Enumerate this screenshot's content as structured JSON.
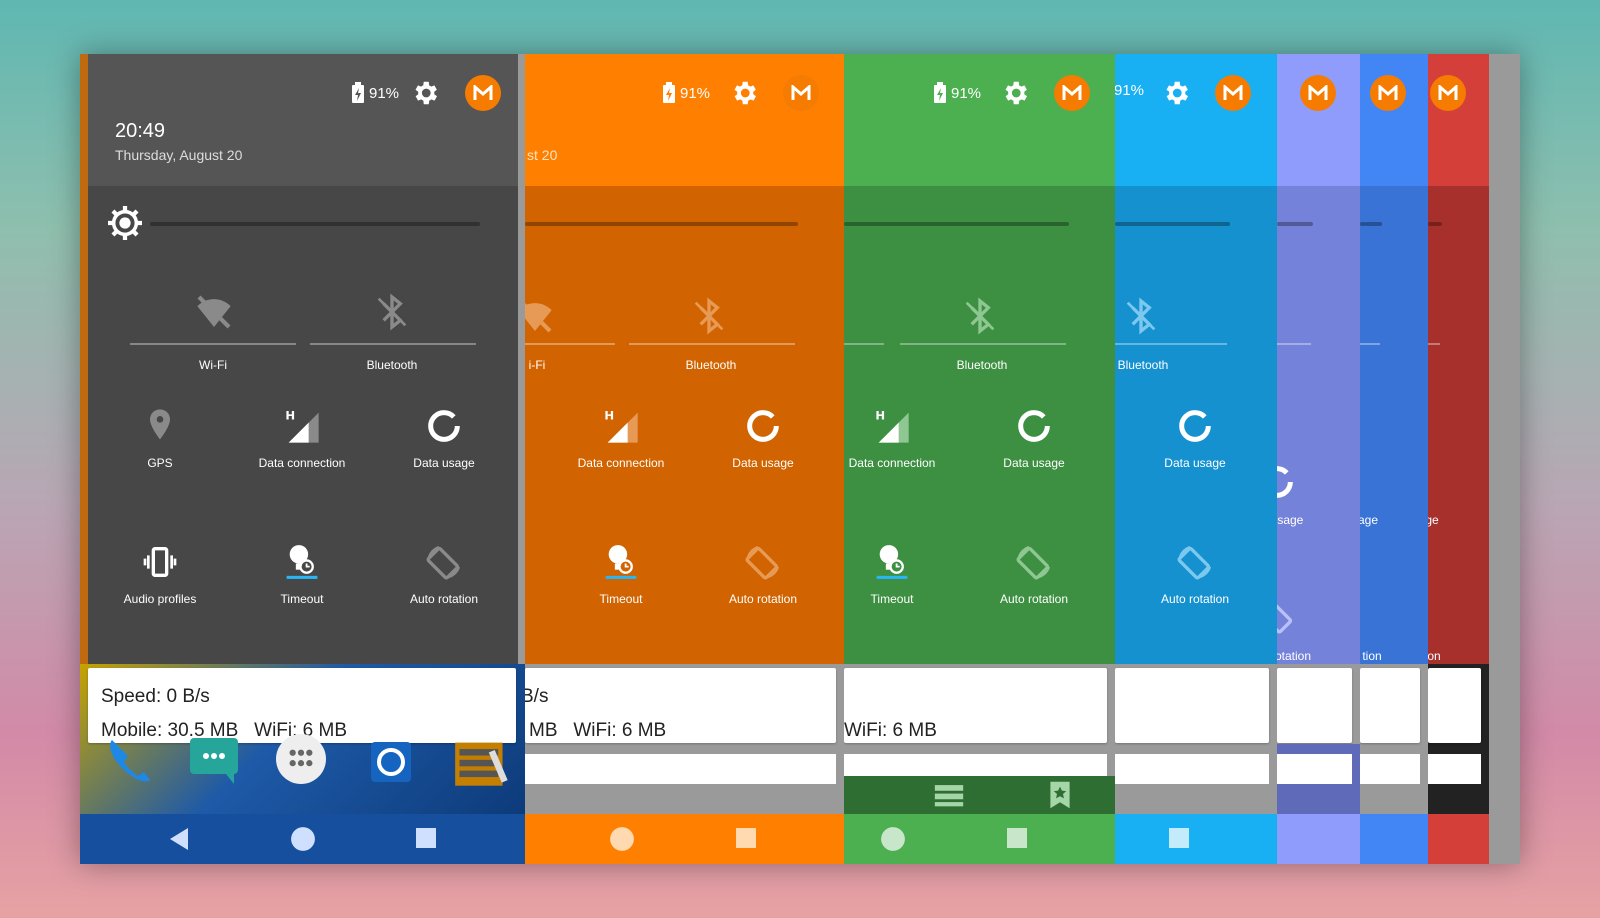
{
  "status": {
    "battery": "91%"
  },
  "clock": {
    "time": "20:49",
    "date": "Thursday, August 20",
    "date_partial": "st 20"
  },
  "tiles": {
    "wifi": "Wi-Fi",
    "wifi_partial": "i-Fi",
    "bluetooth": "Bluetooth",
    "gps": "GPS",
    "data_connection": "Data connection",
    "data_usage": "Data usage",
    "data_usage_p1": "usage",
    "data_usage_p2": "age",
    "data_usage_p3": "ge",
    "audio_profiles": "Audio profiles",
    "timeout": "Timeout",
    "auto_rotation": "Auto rotation",
    "auto_rotation_p1": "otation",
    "auto_rotation_p2": "tion",
    "auto_rotation_p3": "on"
  },
  "notification": {
    "speed": "Speed: 0 B/s",
    "speed_partial": "B/s",
    "mobile": "Mobile: 30.5 MB",
    "mobile_partial": "MB",
    "wifi": "WiFi: 6 MB"
  },
  "colors": {
    "dark": "#4a4a4a",
    "orange": "#ff7f00",
    "green": "#4caf50",
    "blue": "#18b0f2",
    "periwinkle": "#8f9cfb",
    "royal": "#4285f4",
    "red": "#d43f3a",
    "accent": "#f57c00"
  }
}
